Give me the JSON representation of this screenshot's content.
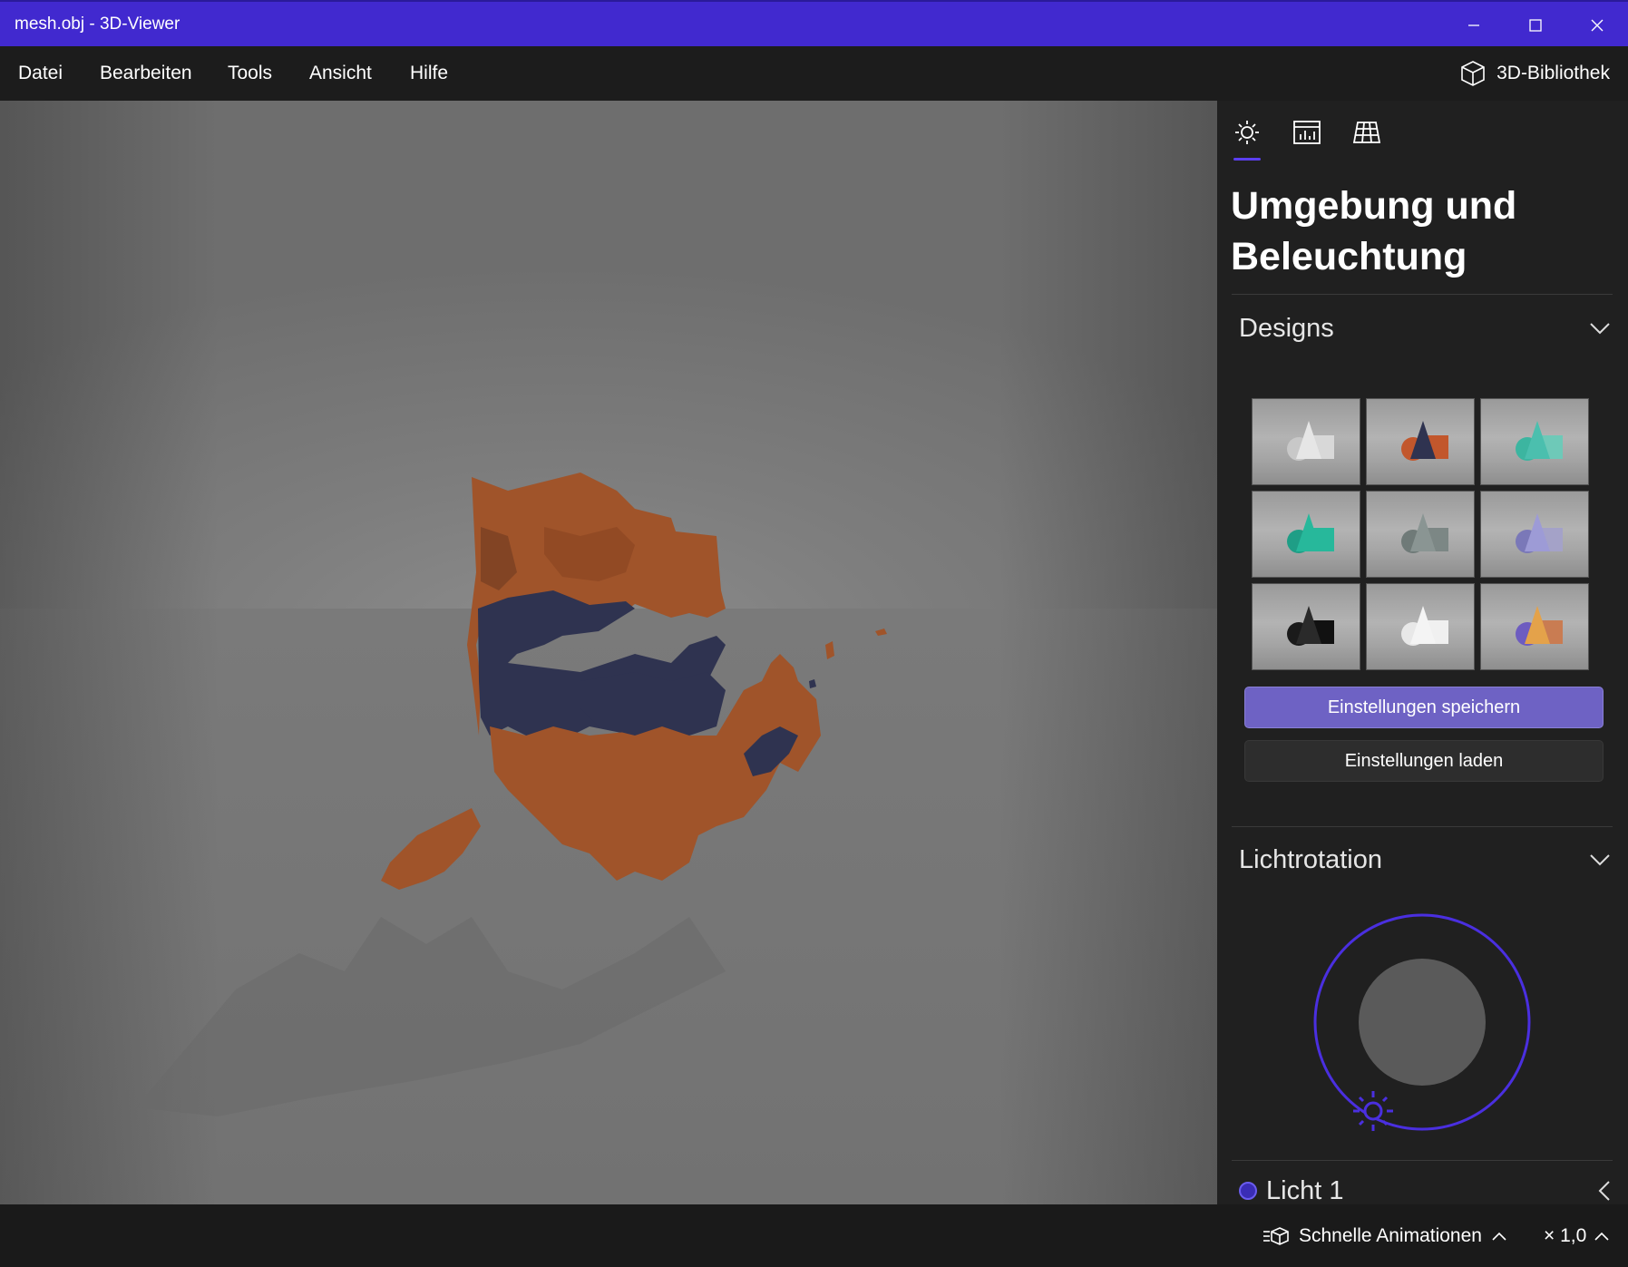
{
  "window": {
    "title": "mesh.obj - 3D-Viewer"
  },
  "menu": {
    "items": [
      "Datei",
      "Bearbeiten",
      "Tools",
      "Ansicht",
      "Hilfe"
    ],
    "library_label": "3D-Bibliothek"
  },
  "panel": {
    "tabs": [
      "environment-lighting-icon",
      "stats-icon",
      "grid-icon"
    ],
    "title_line1": "Umgebung und",
    "title_line2": "Beleuchtung",
    "designs_label": "Designs",
    "designs": [
      {
        "sphere": "#c8c8c8",
        "cube": "#d8d8d8",
        "cone": "#e6e6e6"
      },
      {
        "sphere": "#c2572c",
        "cube": "#c2572c",
        "cone": "#2f3350"
      },
      {
        "sphere": "#3cb5a0",
        "cube": "#6ec9b8",
        "cone": "#4bbfae"
      },
      {
        "sphere": "#1f9e86",
        "cube": "#27b89b",
        "cone": "#27b89b"
      },
      {
        "sphere": "#6f7a78",
        "cube": "#7c8785",
        "cone": "#8a9593"
      },
      {
        "sphere": "#7a78b8",
        "cube": "#a4a2c8",
        "cone": "#9d9bd6"
      },
      {
        "sphere": "#1a1a1a",
        "cube": "#111111",
        "cone": "#2a2a2a"
      },
      {
        "sphere": "#e8e8e8",
        "cube": "#f0f0f0",
        "cone": "#f4f4f4"
      },
      {
        "sphere": "#6d5cc0",
        "cube": "#c97c52",
        "cone": "#e4a24a"
      }
    ],
    "save_button": "Einstellungen speichern",
    "load_button": "Einstellungen laden",
    "rotation_label": "Lichtrotation",
    "light_label": "Licht 1"
  },
  "status": {
    "animations_label": "Schnelle Animationen",
    "speed_label": "× 1,0"
  },
  "colors": {
    "accent": "#4129cf",
    "button_primary": "#6e62c4",
    "mesh": "#a0542a"
  }
}
